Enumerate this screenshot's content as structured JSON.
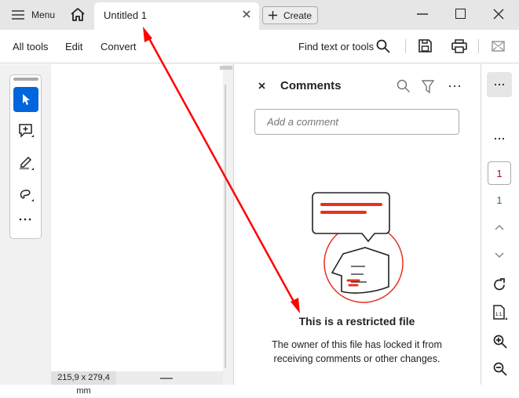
{
  "titlebar": {
    "menu_label": "Menu",
    "tab_title": "Untitled 1",
    "create_label": "Create"
  },
  "toolbar": {
    "all_tools": "All tools",
    "edit": "Edit",
    "convert": "Convert",
    "find": "Find text or tools"
  },
  "comments": {
    "title": "Comments",
    "placeholder": "Add a comment",
    "restricted_title": "This is a restricted file",
    "restricted_line1": "The owner of this file has locked it from",
    "restricted_line2": "receiving comments or other changes."
  },
  "rail": {
    "page_input": "1",
    "page_total": "1"
  },
  "status": {
    "page_size": "215,9 x 279,4 mm"
  },
  "colors": {
    "accent": "#0265dc",
    "annotation": "#ff0000"
  }
}
